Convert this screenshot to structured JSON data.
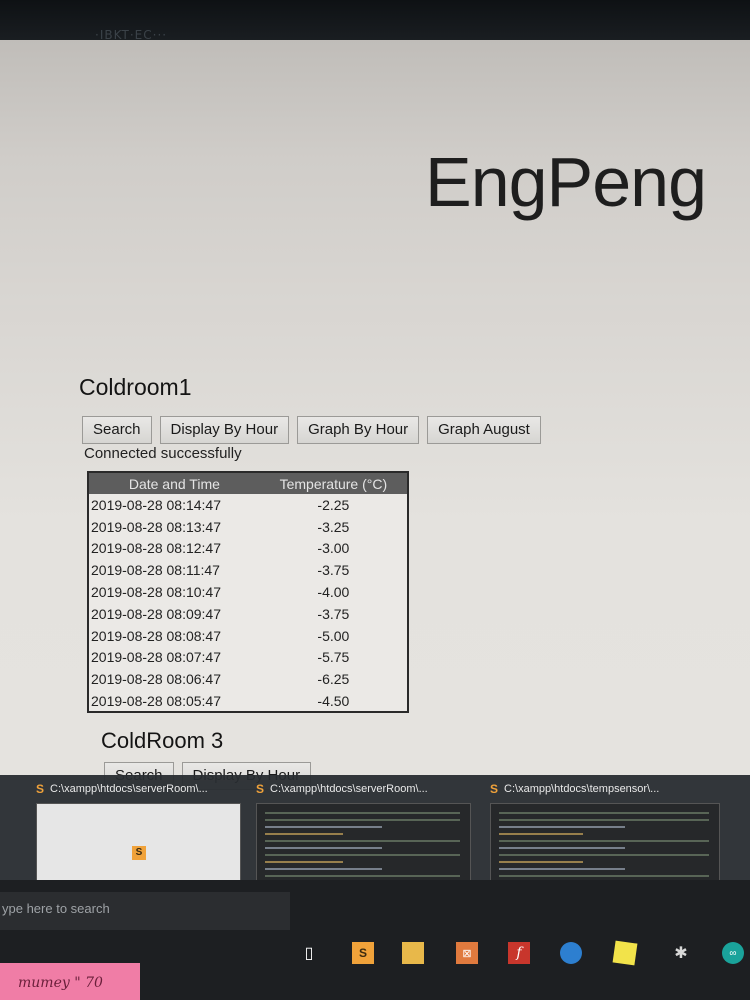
{
  "bezel": {
    "faint_text": "·IBKT·EC···"
  },
  "header": {
    "brand": "EngPeng"
  },
  "coldroom1": {
    "title": "Coldroom1",
    "buttons": {
      "search": "Search",
      "display_by_hour": "Display By Hour",
      "graph_by_hour": "Graph By Hour",
      "graph_august": "Graph August"
    },
    "status": "Connected successfully",
    "table": {
      "headers": {
        "datetime": "Date and Time",
        "temperature": "Temperature (°C)"
      },
      "rows": [
        {
          "datetime": "2019-08-28 08:14:47",
          "temperature": "-2.25"
        },
        {
          "datetime": "2019-08-28 08:13:47",
          "temperature": "-3.25"
        },
        {
          "datetime": "2019-08-28 08:12:47",
          "temperature": "-3.00"
        },
        {
          "datetime": "2019-08-28 08:11:47",
          "temperature": "-3.75"
        },
        {
          "datetime": "2019-08-28 08:10:47",
          "temperature": "-4.00"
        },
        {
          "datetime": "2019-08-28 08:09:47",
          "temperature": "-3.75"
        },
        {
          "datetime": "2019-08-28 08:08:47",
          "temperature": "-5.00"
        },
        {
          "datetime": "2019-08-28 08:07:47",
          "temperature": "-5.75"
        },
        {
          "datetime": "2019-08-28 08:06:47",
          "temperature": "-6.25"
        },
        {
          "datetime": "2019-08-28 08:05:47",
          "temperature": "-4.50"
        }
      ]
    }
  },
  "coldroom3": {
    "title": "ColdRoom 3",
    "buttons": {
      "search": "Search",
      "display_by_hour": "Display By Hour"
    }
  },
  "thumbnails": [
    {
      "caption": "C:\\xampp\\htdocs\\serverRoom\\..."
    },
    {
      "caption": "C:\\xampp\\htdocs\\serverRoom\\..."
    },
    {
      "caption": "C:\\xampp\\htdocs\\tempsensor\\..."
    }
  ],
  "taskbar": {
    "search_placeholder": "ype here to search"
  },
  "sticky_note": "mumey \" 70",
  "colors": {
    "table_header_bg": "#5d5d5d",
    "sublime_orange": "#f0a23a",
    "sticky_pink": "#f07da6"
  }
}
